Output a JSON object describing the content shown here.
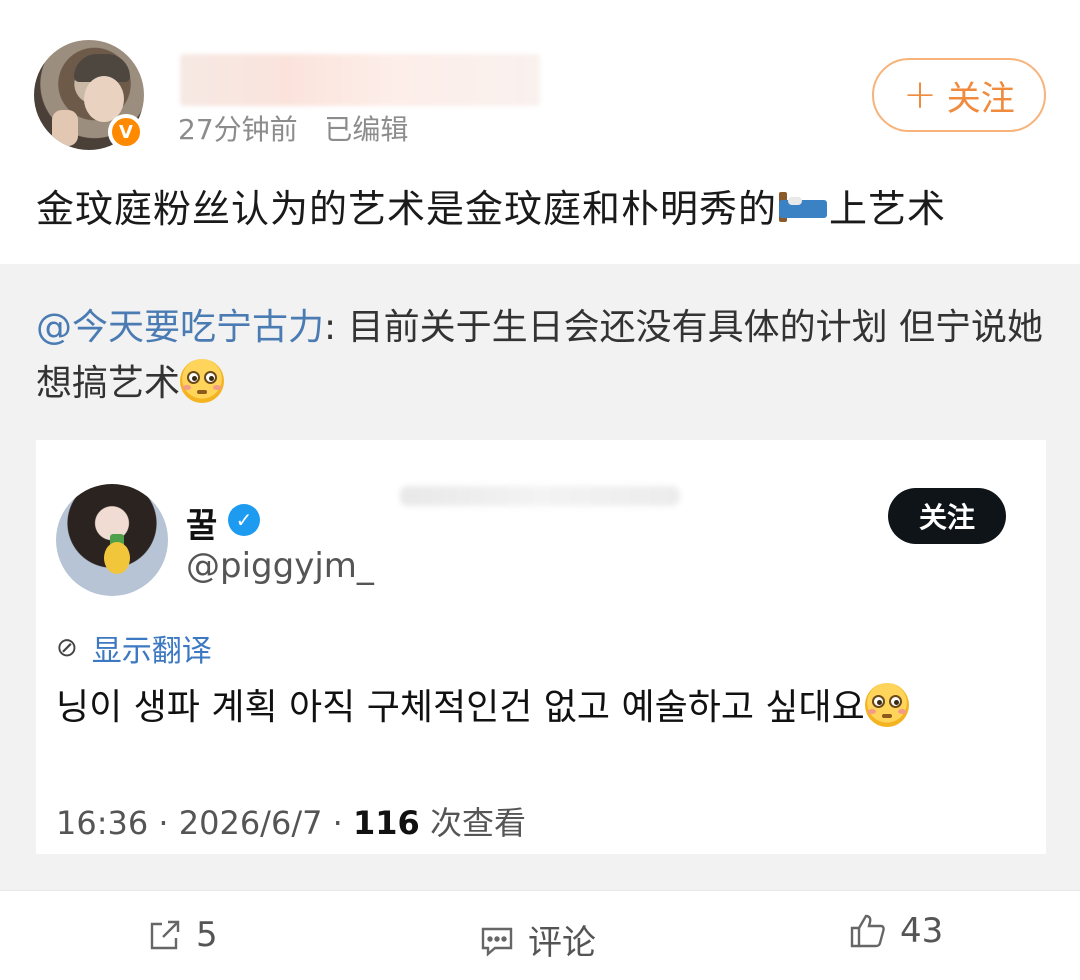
{
  "post": {
    "time": "27分钟前",
    "edited": "已编辑",
    "follow_label": "关注",
    "text_before": "金玟庭粉丝认为的艺术是金玟庭和朴明秀的",
    "text_after": "上艺术",
    "emoji": "bed-emoji"
  },
  "repost": {
    "mention": "@今天要吃宁古力",
    "text": ": 目前关于生日会还没有具体的计划 但宁说她想搞艺术",
    "emoji": "flushed-face-emoji"
  },
  "tweet": {
    "name": "꿀",
    "handle": "@piggyjm_",
    "follow_label": "关注",
    "translate_label": "显示翻译",
    "body": "닝이 생파 계획 아직 구체적인건 없고 예술하고 싶대요",
    "time": "16:36 · 2026/6/7 ·",
    "views": "116",
    "views_label": "次查看"
  },
  "actions": {
    "repost_count": "5",
    "comment_label": "评论",
    "like_count": "43"
  },
  "colors": {
    "accent_orange": "#f08a3c",
    "mention_blue": "#4a7bb3",
    "verified_blue": "#1d9bf0"
  }
}
